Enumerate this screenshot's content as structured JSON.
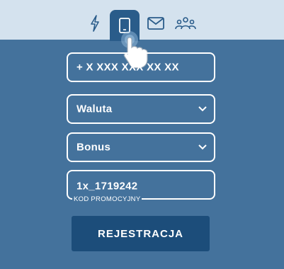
{
  "tabs": [
    {
      "icon": "lightning-icon"
    },
    {
      "icon": "phone-icon",
      "active": true
    },
    {
      "icon": "mail-icon"
    },
    {
      "icon": "people-icon"
    }
  ],
  "form": {
    "phone_placeholder": "+ X XXX XXX XX XX",
    "currency_select": "Waluta",
    "bonus_select": "Bonus",
    "promo_code_value": "1x_1719242",
    "promo_code_label": "KOD PROMOCYJNY",
    "submit_label": "REJESTRACJA"
  },
  "colors": {
    "background": "#44729c",
    "tabbar": "#d4e2ee",
    "active_tab": "#2a5c8a",
    "button": "#1c4d7a",
    "text": "#ffffff"
  }
}
